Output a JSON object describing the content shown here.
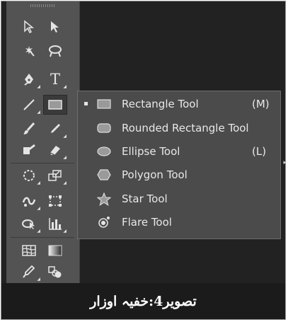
{
  "flyout": {
    "items": [
      {
        "label": "Rectangle Tool",
        "shortcut": "(M)",
        "icon": "rectangle-icon",
        "selected": true
      },
      {
        "label": "Rounded Rectangle Tool",
        "shortcut": "",
        "icon": "rounded-rectangle-icon",
        "selected": false
      },
      {
        "label": "Ellipse Tool",
        "shortcut": "(L)",
        "icon": "ellipse-icon",
        "selected": false
      },
      {
        "label": "Polygon Tool",
        "shortcut": "",
        "icon": "polygon-icon",
        "selected": false
      },
      {
        "label": "Star Tool",
        "shortcut": "",
        "icon": "star-icon",
        "selected": false
      },
      {
        "label": "Flare Tool",
        "shortcut": "",
        "icon": "flare-icon",
        "selected": false
      }
    ]
  },
  "toolbar": {
    "type_tool_glyph": "T"
  },
  "caption": {
    "text": "تصویر4:خفیہ اوزار"
  },
  "colors": {
    "panel": "#535353",
    "flyout": "#4b4b4b",
    "background": "#1b1b1b"
  }
}
